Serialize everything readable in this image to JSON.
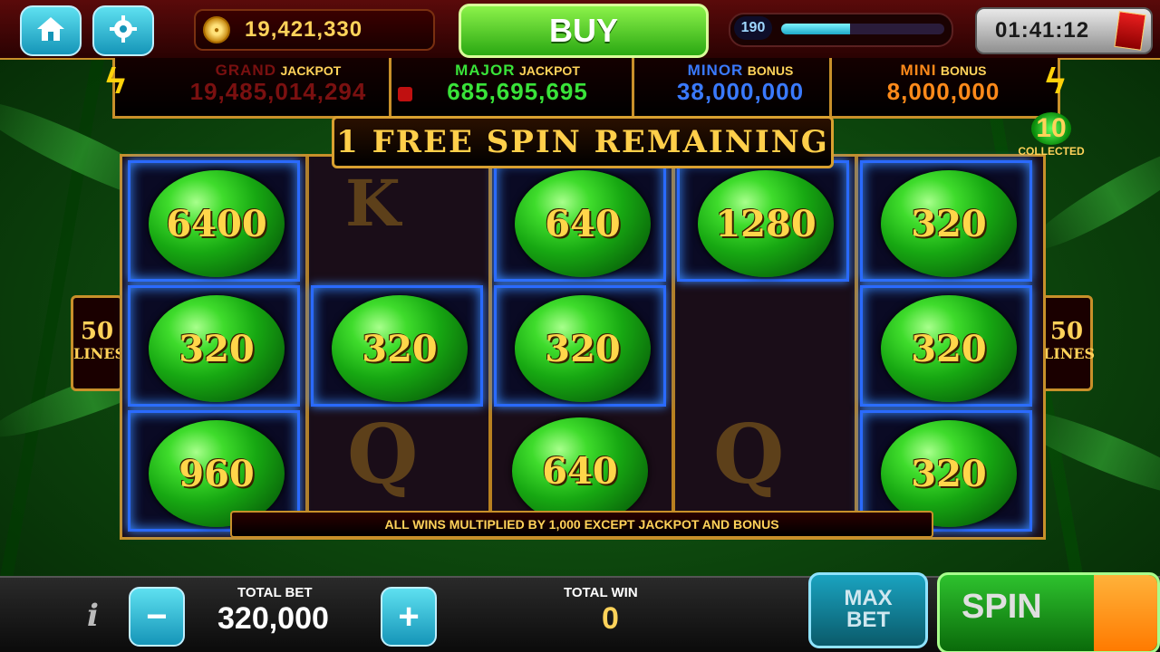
{
  "top": {
    "coin_balance": "19,421,330",
    "buy_label": "BUY",
    "level": "190",
    "level_progress": 0.42,
    "timer": "01:41:12"
  },
  "jackpots": [
    {
      "name": "GRAND",
      "suffix": "JACKPOT",
      "value": "19,485,014,294",
      "color": "#7a1010"
    },
    {
      "name": "MAJOR",
      "suffix": "JACKPOT",
      "value": "685,695,695",
      "color": "#39e339"
    },
    {
      "name": "MINOR",
      "suffix": "BONUS",
      "value": "38,000,000",
      "color": "#3a7aff"
    },
    {
      "name": "MINI",
      "suffix": "BONUS",
      "value": "8,000,000",
      "color": "#ff8a1a"
    }
  ],
  "free_spins": {
    "banner": "1 FREE SPIN REMAINING",
    "collected_count": "10",
    "collected_label": "COLLECTED"
  },
  "lines": {
    "num": "50",
    "label": "LINES"
  },
  "reels": {
    "cells": [
      {
        "col": 0,
        "row": 0,
        "gem": "6400"
      },
      {
        "col": 2,
        "row": 0,
        "gem": "640"
      },
      {
        "col": 3,
        "row": 0,
        "gem": "1280"
      },
      {
        "col": 4,
        "row": 0,
        "gem": "320"
      },
      {
        "col": 0,
        "row": 1,
        "gem": "320"
      },
      {
        "col": 1,
        "row": 1,
        "gem": "320"
      },
      {
        "col": 2,
        "row": 1,
        "gem": "320"
      },
      {
        "col": 4,
        "row": 1,
        "gem": "320"
      },
      {
        "col": 0,
        "row": 2,
        "gem": "960"
      },
      {
        "col": 2,
        "row": 2,
        "gem": "640"
      },
      {
        "col": 4,
        "row": 2,
        "gem": "320"
      }
    ],
    "ghost_symbols": [
      "K",
      "Q",
      "Q"
    ]
  },
  "multiplier_banner": "ALL WINS MULTIPLIED BY 1,000 EXCEPT JACKPOT AND BONUS",
  "bottom": {
    "info": "i",
    "minus": "−",
    "plus": "+",
    "total_bet_label": "TOTAL BET",
    "total_bet": "320,000",
    "total_win_label": "TOTAL WIN",
    "total_win": "0",
    "maxbet_line1": "MAX",
    "maxbet_line2": "BET",
    "spin_label": "SPIN"
  }
}
